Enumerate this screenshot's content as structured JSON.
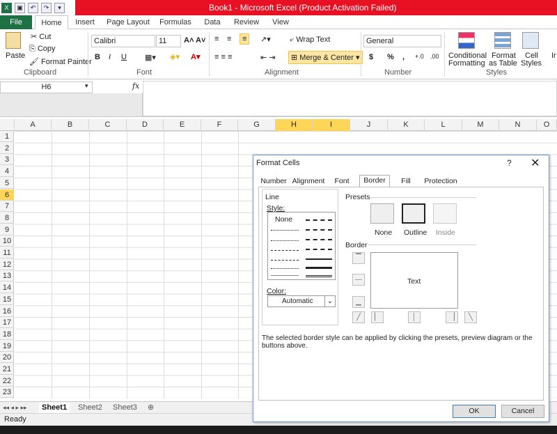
{
  "window": {
    "title": "Book1  -  Microsoft Excel (Product Activation Failed)",
    "title_bar_color": "#e81123"
  },
  "ribbon_tabs": [
    "File",
    "Home",
    "Insert",
    "Page Layout",
    "Formulas",
    "Data",
    "Review",
    "View"
  ],
  "clipboard": {
    "paste": "Paste",
    "cut": "Cut",
    "copy": "Copy",
    "format_painter": "Format Painter",
    "group": "Clipboard"
  },
  "font": {
    "name": "Calibri",
    "size": "11",
    "bold": "B",
    "italic": "I",
    "underline": "U",
    "group": "Font"
  },
  "alignment": {
    "wrap_text": "Wrap Text",
    "merge_center": "Merge & Center",
    "group": "Alignment"
  },
  "number": {
    "format": "General",
    "currency": "$",
    "percent": "%",
    "comma": ",",
    "inc_decimal": ".0→.00",
    "dec_decimal": ".00→.0",
    "group": "Number"
  },
  "styles": {
    "conditional": "Conditional",
    "conditional2": "Formatting",
    "format_as": "Format",
    "format_as2": "as Table",
    "cell": "Cell",
    "cell2": "Styles",
    "group": "Styles",
    "insert": "Ir"
  },
  "formula_bar": {
    "name_box": "H6",
    "fx": "fx"
  },
  "columns": [
    "A",
    "B",
    "C",
    "D",
    "E",
    "F",
    "G",
    "H",
    "I",
    "J",
    "K",
    "L",
    "M",
    "N",
    "O"
  ],
  "selected_columns": [
    "H",
    "I"
  ],
  "rows": [
    "1",
    "2",
    "3",
    "4",
    "5",
    "6",
    "7",
    "8",
    "9",
    "10",
    "11",
    "12",
    "13",
    "14",
    "15",
    "16",
    "17",
    "18",
    "19",
    "20",
    "21",
    "22",
    "23"
  ],
  "selected_row": "6",
  "sheets": [
    "Sheet1",
    "Sheet2",
    "Sheet3"
  ],
  "status": "Ready",
  "dialog": {
    "title": "Format Cells",
    "help": "?",
    "close": "✕",
    "tabs": [
      "Number",
      "Alignment",
      "Font",
      "Border",
      "Fill",
      "Protection"
    ],
    "active_tab": "Border",
    "line_label": "Line",
    "style_label": "Style:",
    "style_none": "None",
    "color_label": "Color:",
    "color_value": "Automatic",
    "presets_label": "Presets",
    "preset_none": "None",
    "preset_outline": "Outline",
    "preset_inside": "Inside",
    "border_label": "Border",
    "preview_text": "Text",
    "note": "The selected border style can be applied by clicking the presets, preview diagram or the buttons above.",
    "ok": "OK",
    "cancel": "Cancel"
  }
}
